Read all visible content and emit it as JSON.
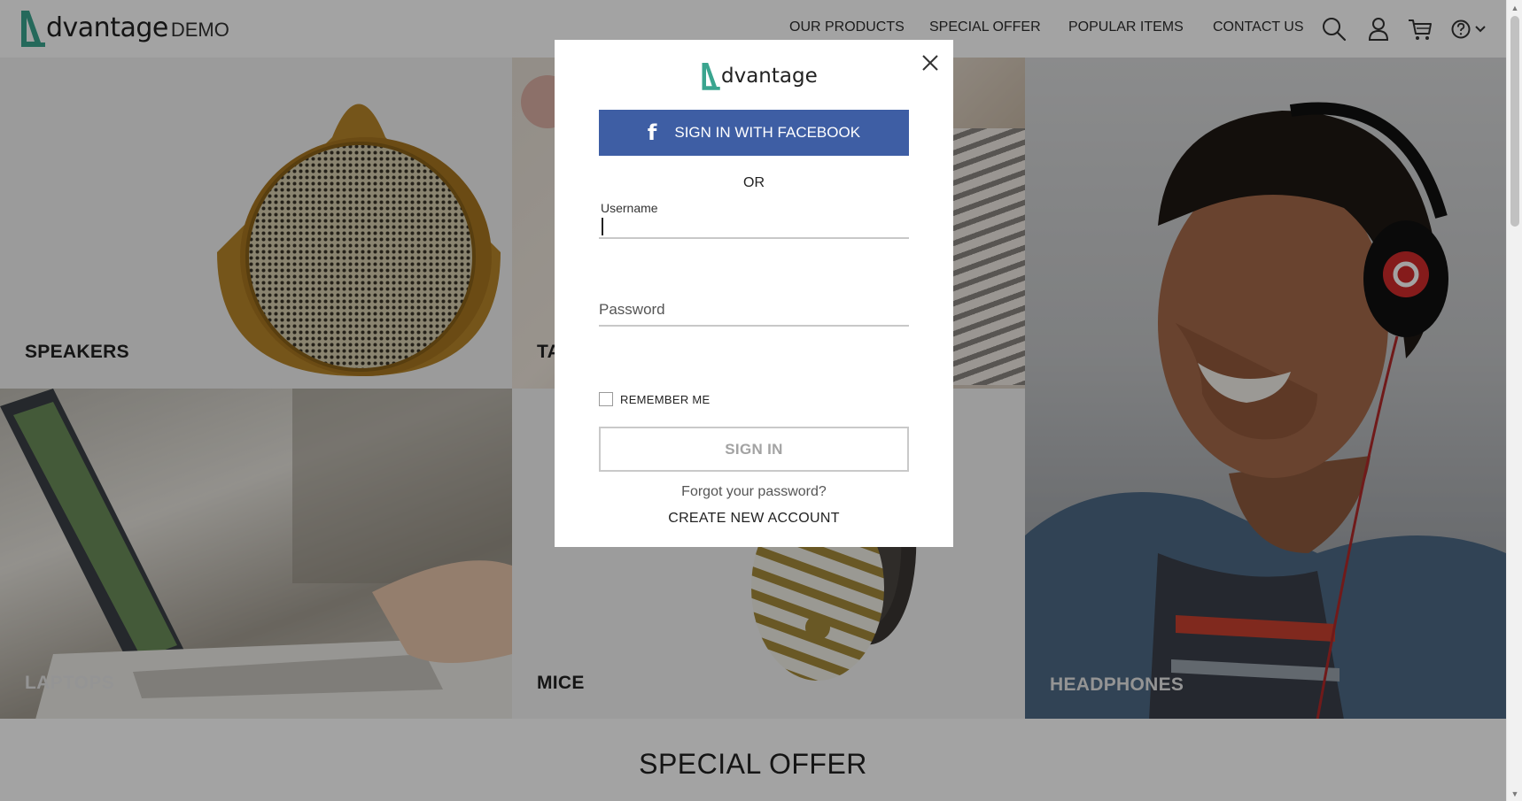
{
  "header": {
    "logo_text": "dvantage",
    "logo_suffix": "DEMO",
    "nav": [
      "OUR PRODUCTS",
      "SPECIAL OFFER",
      "POPULAR ITEMS",
      "CONTACT US"
    ],
    "icons": [
      "search-icon",
      "user-icon",
      "cart-icon",
      "help-icon",
      "chevron-down-icon"
    ]
  },
  "categories": {
    "speakers": "SPEAKERS",
    "tablets": "TA",
    "laptops": "LAPTOPS",
    "mice": "MICE",
    "headphones": "HEADPHONES"
  },
  "special_offer": {
    "title": "SPECIAL OFFER"
  },
  "modal": {
    "logo_text": "dvantage",
    "facebook_label": "SIGN IN WITH FACEBOOK",
    "or_text": "OR",
    "username_label": "Username",
    "username_value": "",
    "password_placeholder": "Password",
    "remember_label": "REMEMBER ME",
    "remember_checked": false,
    "signin_label": "SIGN IN",
    "forgot_label": "Forgot your password?",
    "create_label": "CREATE NEW ACCOUNT"
  },
  "colors": {
    "brand_teal": "#3aa58f",
    "facebook_blue": "#3e5ea4",
    "overlay": "rgba(0,0,0,0.36)"
  }
}
